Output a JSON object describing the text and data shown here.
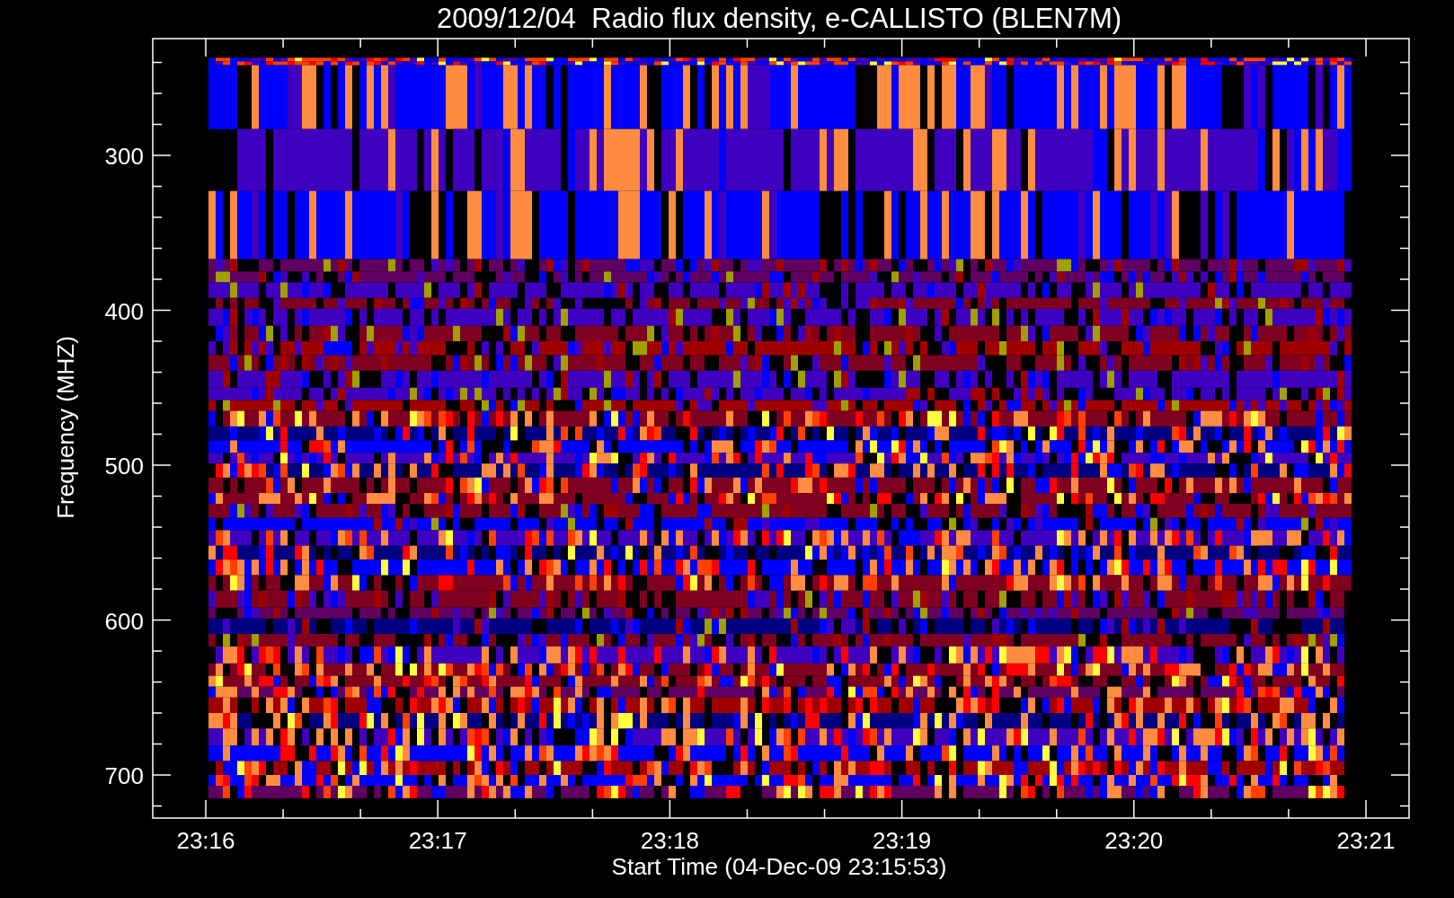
{
  "title": "2009/12/04  Radio flux density, e-CALLISTO (BLEN7M)",
  "ylabel": "Frequency (MHZ)",
  "xlabel": "Start Time (04-Dec-09 23:15:53)",
  "yticks": [
    "300",
    "400",
    "500",
    "600",
    "700"
  ],
  "xticks": [
    "23:16",
    "23:17",
    "23:18",
    "23:19",
    "23:20",
    "23:21"
  ]
}
